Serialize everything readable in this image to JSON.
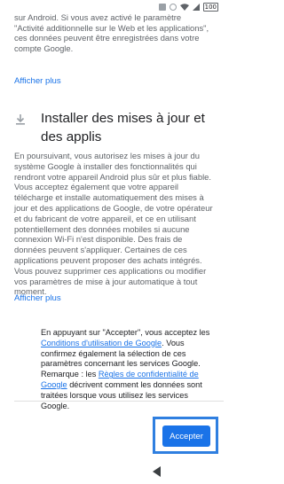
{
  "status_bar": {
    "battery": "100",
    "icons": [
      "notification-icon",
      "alarm-icon",
      "wifi-icon",
      "signal-icon",
      "battery-icon"
    ]
  },
  "content": {
    "top_paragraph": "Google et à nos partenaires les sites que vous visitez sur Android. Si vous avez activé le paramètre \"Activité additionnelle sur le Web et les applications\", ces données peuvent être enregistrées dans votre compte Google.",
    "show_more_1": "Afficher plus",
    "section_title": "Installer des mises à jour et des applis",
    "section_paragraph": "En poursuivant, vous autorisez les mises à jour du système Google à installer des fonctionnalités qui rendront votre appareil Android plus sûr et plus fiable. Vous acceptez également que votre appareil télécharge et installe automatiquement des mises à jour et des applications de Google, de votre opérateur et du fabricant de votre appareil, et ce en utilisant potentiellement des données mobiles si aucune connexion Wi-Fi n'est disponible. Des frais de données peuvent s'appliquer. Certaines de ces applications peuvent proposer des achats intégrés. Vous pouvez supprimer ces applications ou modifier vos paramètres de mise à jour automatique à tout moment.",
    "show_more_2": "Afficher plus"
  },
  "consent": {
    "part1": "En appuyant sur \"Accepter\", vous acceptez les ",
    "terms_link": "Conditions d'utilisation de Google",
    "part2": ". Vous confirmez également la sélection de ces paramètres concernant les services Google. Remarque : les ",
    "privacy_link": "Règles de confidentialité de Google",
    "part3": " décrivent comment les données sont traitées lorsque vous utilisez les services Google."
  },
  "footer": {
    "accept_label": "Accepter"
  },
  "colors": {
    "accent": "#1a73e8",
    "highlight": "#2f7fe0"
  }
}
